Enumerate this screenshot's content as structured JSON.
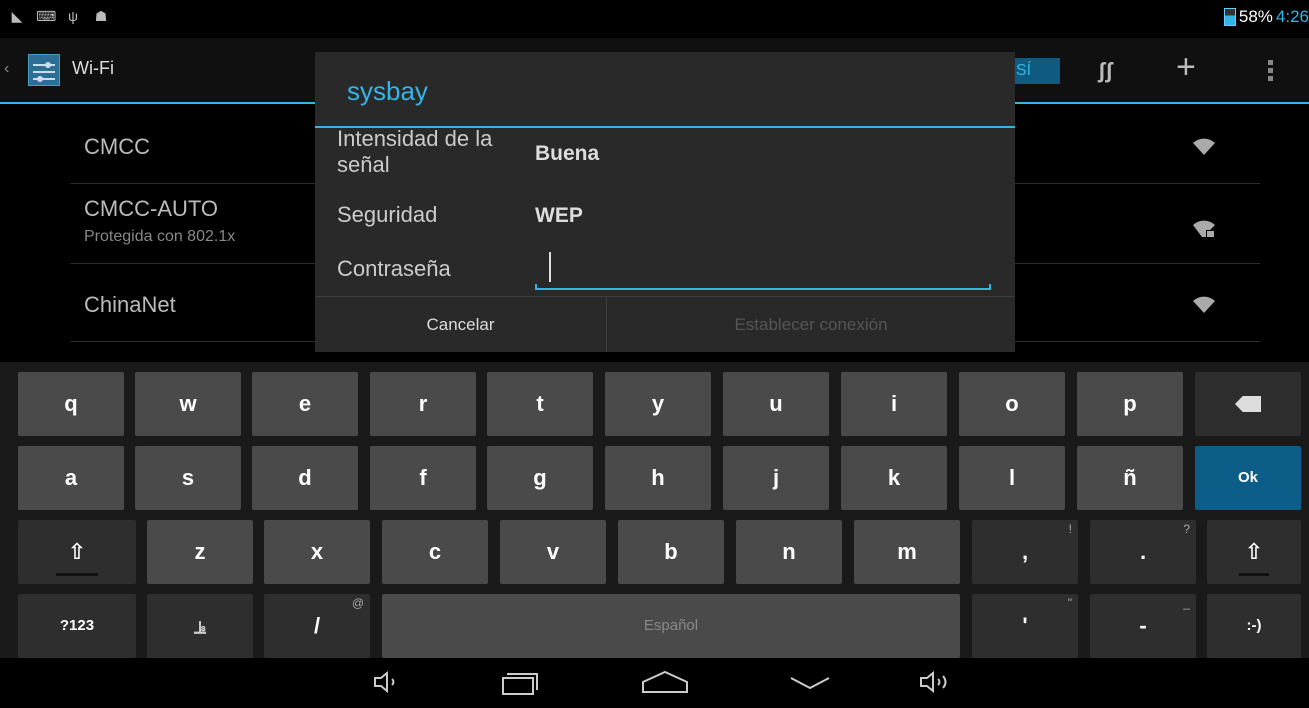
{
  "status": {
    "icons": [
      "screenshot-icon",
      "keyboard-icon",
      "usb-icon",
      "android-debug-icon"
    ],
    "battery": "58%",
    "time": "4:26"
  },
  "actionbar": {
    "title": "Wi-Fi",
    "toggle_label": "SÍ"
  },
  "networks": [
    {
      "name": "CMCC",
      "subtitle": ""
    },
    {
      "name": "CMCC-AUTO",
      "subtitle": "Protegida con 802.1x"
    },
    {
      "name": "ChinaNet",
      "subtitle": ""
    }
  ],
  "dialog": {
    "title": "sysbay",
    "signal_label": "Intensidad de la señal",
    "signal_value": "Buena",
    "security_label": "Seguridad",
    "security_value": "WEP",
    "password_label": "Contraseña",
    "password_value": "",
    "cancel_label": "Cancelar",
    "connect_label": "Establecer conexión"
  },
  "keyboard": {
    "row1": [
      "q",
      "w",
      "e",
      "r",
      "t",
      "y",
      "u",
      "i",
      "o",
      "p"
    ],
    "row2": [
      "a",
      "s",
      "d",
      "f",
      "g",
      "h",
      "j",
      "k",
      "l",
      "ñ"
    ],
    "row3": [
      "z",
      "x",
      "c",
      "v",
      "b",
      "n",
      "m",
      ",",
      "."
    ],
    "row3_hints": [
      "!",
      "?"
    ],
    "ok_label": "Ok",
    "symbols_label": "?123",
    "slash_label": "/",
    "slash_hint": "@",
    "space_label": "Español",
    "apostrophe_label": "'",
    "apostrophe_hint": "\"",
    "dash_label": "-",
    "dash_hint": "_",
    "smiley_label": ":-)"
  }
}
